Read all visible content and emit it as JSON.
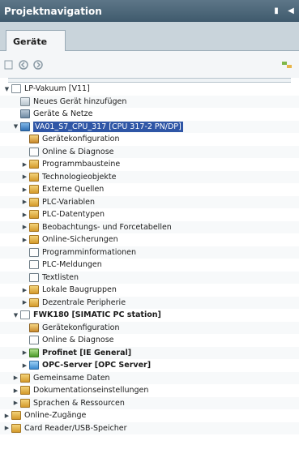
{
  "window": {
    "title": "Projektnavigation",
    "controls": [
      "pin-icon",
      "collapse-icon"
    ]
  },
  "tabs": [
    {
      "label": "Geräte"
    }
  ],
  "toolbar": {
    "buttons": [
      "new-icon",
      "back-icon",
      "forward-icon",
      "network-icon"
    ]
  },
  "tree": [
    {
      "id": "lp-vakuum",
      "label": "LP-Vakuum [V11]",
      "caret": "▼",
      "icon": "doc",
      "depth": 0
    },
    {
      "id": "neues-geraet",
      "label": "Neues Gerät hinzufügen",
      "caret": "",
      "icon": "add",
      "depth": 1
    },
    {
      "id": "geraete-netze",
      "label": "Geräte & Netze",
      "caret": "",
      "icon": "net",
      "depth": 1
    },
    {
      "id": "va01",
      "label": "VA01_S7_CPU_317 [CPU 317-2 PN/DP]",
      "caret": "▼",
      "icon": "cpu",
      "depth": 1,
      "selected": true
    },
    {
      "id": "geraetekonfig-1",
      "label": "Gerätekonfiguration",
      "caret": "",
      "icon": "tool",
      "depth": 2
    },
    {
      "id": "online-diagnose-1",
      "label": "Online & Diagnose",
      "caret": "",
      "icon": "sheet",
      "depth": 2
    },
    {
      "id": "programmbausteine",
      "label": "Programmbausteine",
      "caret": "▶",
      "icon": "folder",
      "depth": 2
    },
    {
      "id": "technologieobjekte",
      "label": "Technologieobjekte",
      "caret": "▶",
      "icon": "folder",
      "depth": 2
    },
    {
      "id": "externe-quellen",
      "label": "Externe Quellen",
      "caret": "▶",
      "icon": "folder",
      "depth": 2
    },
    {
      "id": "plc-variablen",
      "label": "PLC-Variablen",
      "caret": "▶",
      "icon": "folder",
      "depth": 2
    },
    {
      "id": "plc-datentypen",
      "label": "PLC-Datentypen",
      "caret": "▶",
      "icon": "folder",
      "depth": 2
    },
    {
      "id": "beobachtungs",
      "label": "Beobachtungs- und Forcetabellen",
      "caret": "▶",
      "icon": "folder",
      "depth": 2
    },
    {
      "id": "online-sicherungen",
      "label": "Online-Sicherungen",
      "caret": "▶",
      "icon": "folder",
      "depth": 2
    },
    {
      "id": "programminformationen",
      "label": "Programminformationen",
      "caret": "",
      "icon": "sheet",
      "depth": 2
    },
    {
      "id": "plc-meldungen",
      "label": "PLC-Meldungen",
      "caret": "",
      "icon": "sheet",
      "depth": 2
    },
    {
      "id": "textlisten",
      "label": "Textlisten",
      "caret": "",
      "icon": "sheet",
      "depth": 2
    },
    {
      "id": "lokale-baugruppen",
      "label": "Lokale Baugruppen",
      "caret": "▶",
      "icon": "folder",
      "depth": 2
    },
    {
      "id": "dezentrale-peripherie",
      "label": "Dezentrale Peripherie",
      "caret": "▶",
      "icon": "folder",
      "depth": 2
    },
    {
      "id": "fwk180",
      "label": "FWK180 [SIMATIC PC station]",
      "caret": "▼",
      "icon": "doc",
      "depth": 1,
      "bold": true
    },
    {
      "id": "geraetekonfig-2",
      "label": "Gerätekonfiguration",
      "caret": "",
      "icon": "tool",
      "depth": 2
    },
    {
      "id": "online-diagnose-2",
      "label": "Online & Diagnose",
      "caret": "",
      "icon": "sheet",
      "depth": 2
    },
    {
      "id": "profinet",
      "label": "Profinet [IE General]",
      "caret": "▶",
      "icon": "green",
      "depth": 2,
      "bold": true
    },
    {
      "id": "opc-server",
      "label": "OPC-Server [OPC Server]",
      "caret": "▶",
      "icon": "blue",
      "depth": 2,
      "bold": true
    },
    {
      "id": "gemeinsame-daten",
      "label": "Gemeinsame Daten",
      "caret": "▶",
      "icon": "folder",
      "depth": 1
    },
    {
      "id": "dokumentationseinstellungen",
      "label": "Dokumentationseinstellungen",
      "caret": "▶",
      "icon": "folder",
      "depth": 1
    },
    {
      "id": "sprachen",
      "label": "Sprachen & Ressourcen",
      "caret": "▶",
      "icon": "folder",
      "depth": 1
    },
    {
      "id": "online-zugaenge",
      "label": "Online-Zugänge",
      "caret": "▶",
      "icon": "folder",
      "depth": 0
    },
    {
      "id": "card-reader",
      "label": "Card Reader/USB-Speicher",
      "caret": "▶",
      "icon": "folder",
      "depth": 0
    }
  ]
}
